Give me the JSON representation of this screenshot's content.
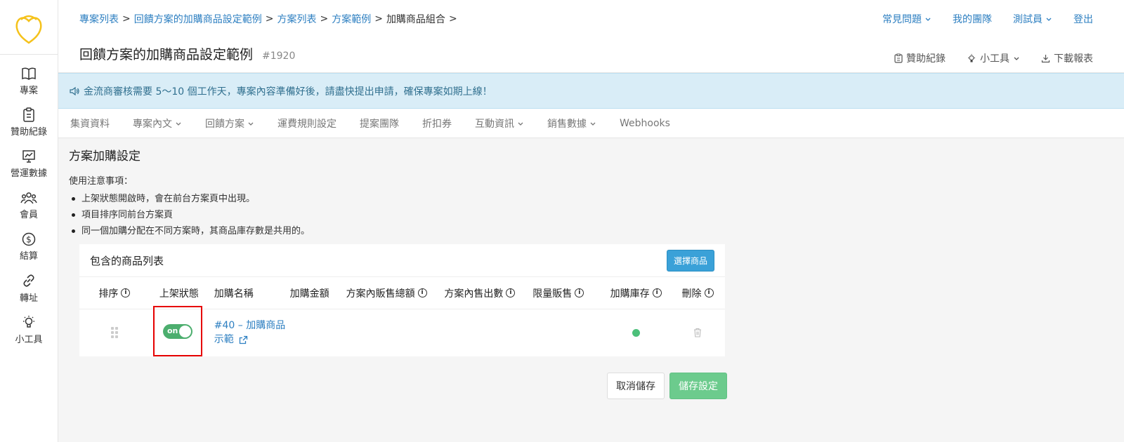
{
  "sidebar": {
    "items": [
      {
        "label": "專案",
        "icon": "book-icon"
      },
      {
        "label": "贊助紀錄",
        "icon": "clipboard-icon"
      },
      {
        "label": "營運數據",
        "icon": "chart-icon"
      },
      {
        "label": "會員",
        "icon": "users-icon"
      },
      {
        "label": "結算",
        "icon": "dollar-icon"
      },
      {
        "label": "轉址",
        "icon": "link-icon"
      },
      {
        "label": "小工具",
        "icon": "bulb-icon"
      }
    ]
  },
  "header": {
    "breadcrumb": [
      "專案列表",
      "回饋方案的加購商品設定範例",
      "方案列表",
      "方案範例",
      "加購商品組合"
    ],
    "nav": {
      "faq": "常見問題",
      "team": "我的團隊",
      "user": "測試員",
      "logout": "登出"
    },
    "title": "回饋方案的加購商品設定範例",
    "id": "#1920",
    "tools": {
      "records": "贊助紀錄",
      "widgets": "小工具",
      "download": "下載報表"
    }
  },
  "notice": "金流商審核需要 5～10 個工作天，專案內容準備好後，請盡快提出申請，確保專案如期上線！",
  "tabs": [
    "集資資料",
    "專案內文",
    "回饋方案",
    "運費規則設定",
    "提案團隊",
    "折扣券",
    "互動資訊",
    "銷售數據",
    "Webhooks"
  ],
  "main": {
    "section_title": "方案加購設定",
    "notes_label": "使用注意事項：",
    "notes": [
      "上架狀態開啟時，會在前台方案頁中出現。",
      "項目排序同前台方案頁",
      "同一個加購分配在不同方案時，其商品庫存數是共用的。"
    ],
    "card_title": "包含的商品列表",
    "select_button": "選擇商品",
    "columns": [
      "排序",
      "上架狀態",
      "加購名稱",
      "加購金額",
      "方案內販售總額",
      "方案內售出數",
      "限量販售",
      "加購庫存",
      "刪除"
    ],
    "row": {
      "toggle_label": "on",
      "name_line1": "#40 – 加購商品",
      "name_line2": "示範"
    },
    "cancel_button": "取消儲存",
    "save_button": "儲存設定"
  }
}
